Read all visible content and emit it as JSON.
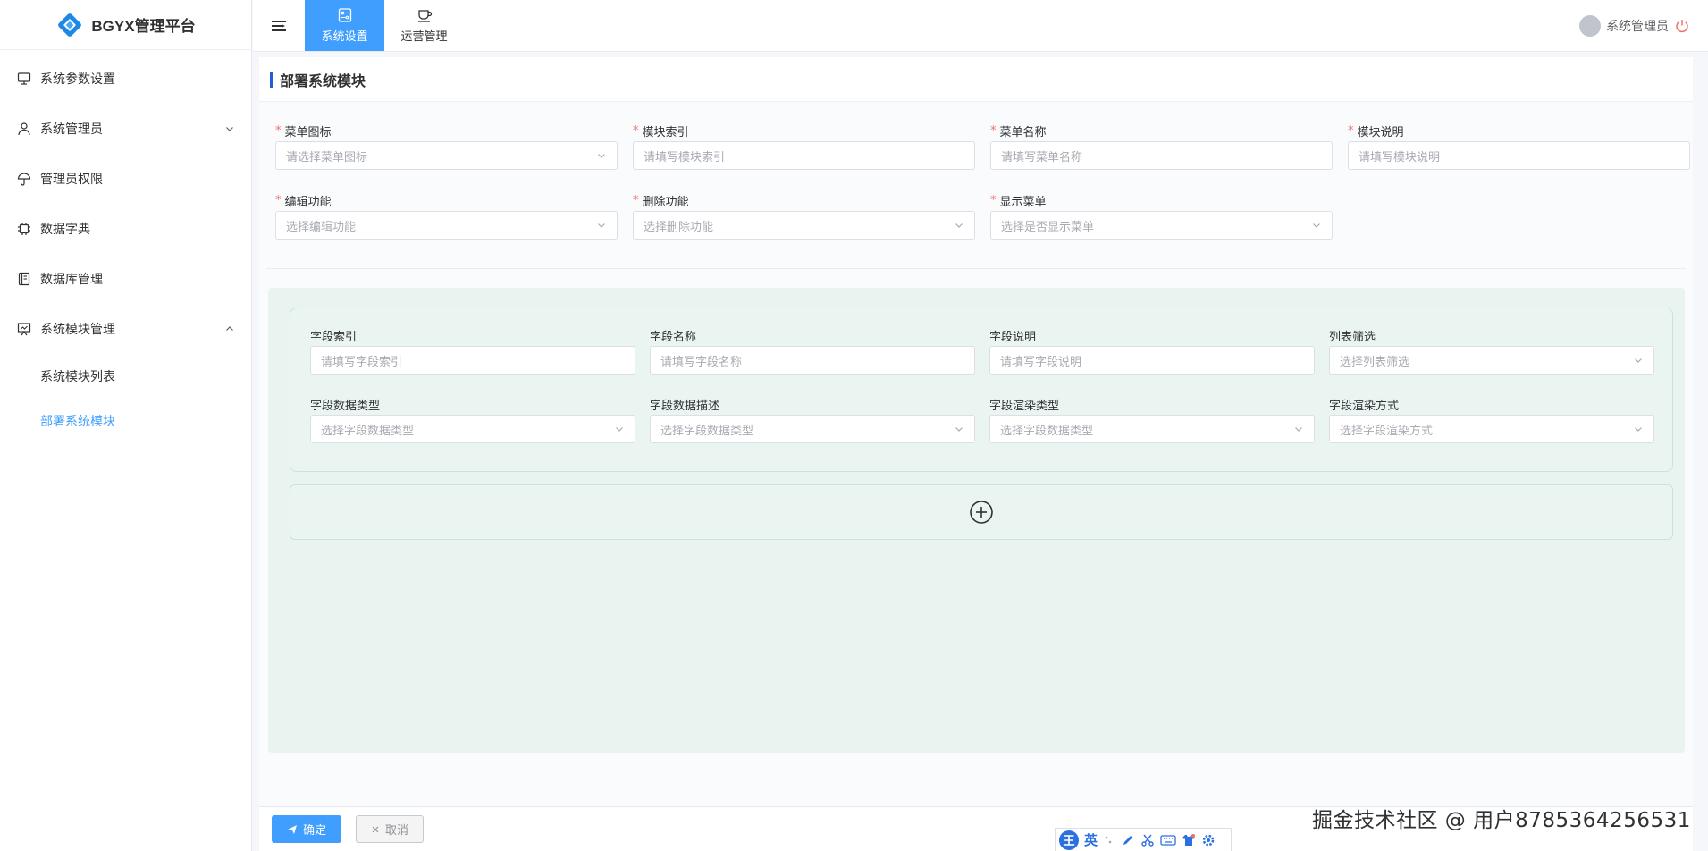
{
  "app": {
    "title": "BGYX管理平台"
  },
  "header": {
    "tabs": [
      {
        "label": "系统设置",
        "icon": "settings-panel-icon",
        "active": true
      },
      {
        "label": "运营管理",
        "icon": "coffee-cup-icon",
        "active": false
      }
    ],
    "user": {
      "name": "系统管理员"
    }
  },
  "sidebar": {
    "items": [
      {
        "label": "系统参数设置",
        "icon": "monitor-icon"
      },
      {
        "label": "系统管理员",
        "icon": "user-icon",
        "expandable": true
      },
      {
        "label": "管理员权限",
        "icon": "umbrella-icon"
      },
      {
        "label": "数据字典",
        "icon": "chip-icon"
      },
      {
        "label": "数据库管理",
        "icon": "notebook-icon"
      },
      {
        "label": "系统模块管理",
        "icon": "presentation-icon",
        "expanded": true
      }
    ],
    "subitems": [
      {
        "label": "系统模块列表",
        "active": false
      },
      {
        "label": "部署系统模块",
        "active": true
      }
    ]
  },
  "page": {
    "title": "部署系统模块"
  },
  "form": {
    "fields": [
      {
        "label": "菜单图标",
        "placeholder": "请选择菜单图标",
        "type": "select",
        "required": true
      },
      {
        "label": "模块索引",
        "placeholder": "请填写模块索引",
        "type": "input",
        "required": true
      },
      {
        "label": "菜单名称",
        "placeholder": "请填写菜单名称",
        "type": "input",
        "required": true
      },
      {
        "label": "模块说明",
        "placeholder": "请填写模块说明",
        "type": "input",
        "required": true
      },
      {
        "label": "编辑功能",
        "placeholder": "选择编辑功能",
        "type": "select",
        "required": true
      },
      {
        "label": "删除功能",
        "placeholder": "选择删除功能",
        "type": "select",
        "required": true
      },
      {
        "label": "显示菜单",
        "placeholder": "选择是否显示菜单",
        "type": "select",
        "required": true
      }
    ]
  },
  "field_card": {
    "fields": [
      {
        "label": "字段索引",
        "placeholder": "请填写字段索引",
        "type": "input"
      },
      {
        "label": "字段名称",
        "placeholder": "请填写字段名称",
        "type": "input"
      },
      {
        "label": "字段说明",
        "placeholder": "请填写字段说明",
        "type": "input"
      },
      {
        "label": "列表筛选",
        "placeholder": "选择列表筛选",
        "type": "select"
      },
      {
        "label": "字段数据类型",
        "placeholder": "选择字段数据类型",
        "type": "select"
      },
      {
        "label": "字段数据描述",
        "placeholder": "选择字段数据类型",
        "type": "select"
      },
      {
        "label": "字段渲染类型",
        "placeholder": "选择字段数据类型",
        "type": "select"
      },
      {
        "label": "字段渲染方式",
        "placeholder": "选择字段渲染方式",
        "type": "select"
      }
    ]
  },
  "actions": {
    "confirm": "确定",
    "cancel": "取消"
  },
  "ime": {
    "char_wang": "王",
    "char_ying": "英"
  },
  "watermark": "掘金技术社区 @ 用户8785364256531",
  "colors": {
    "primary": "#409eff",
    "required": "#f56c6c",
    "panel": "#e9f4f1",
    "title_accent": "#1f5fd6"
  }
}
